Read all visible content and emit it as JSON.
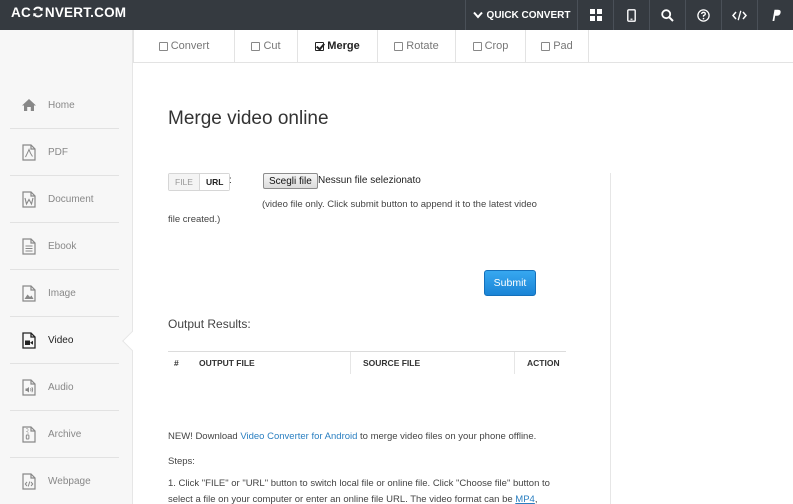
{
  "header": {
    "logo_left": "AC",
    "logo_right": "NVERT.COM",
    "quick_convert": "QUICK CONVERT"
  },
  "tabs": [
    {
      "label": "Convert",
      "active": false
    },
    {
      "label": "Cut",
      "active": false
    },
    {
      "label": "Merge",
      "active": true
    },
    {
      "label": "Rotate",
      "active": false
    },
    {
      "label": "Crop",
      "active": false
    },
    {
      "label": "Pad",
      "active": false
    }
  ],
  "sidebar": {
    "items": [
      {
        "label": "Home",
        "icon": "home-icon"
      },
      {
        "label": "PDF",
        "icon": "pdf-icon"
      },
      {
        "label": "Document",
        "icon": "document-icon"
      },
      {
        "label": "Ebook",
        "icon": "ebook-icon"
      },
      {
        "label": "Image",
        "icon": "image-icon"
      },
      {
        "label": "Video",
        "icon": "video-icon",
        "active": true
      },
      {
        "label": "Audio",
        "icon": "audio-icon"
      },
      {
        "label": "Archive",
        "icon": "archive-icon"
      },
      {
        "label": "Webpage",
        "icon": "webpage-icon"
      }
    ]
  },
  "main": {
    "title": "Merge video online",
    "toggle_file": "FILE",
    "toggle_url": "URL",
    "colon": ":",
    "choose_file": "Scegli file",
    "no_file": "Nessun file selezionato",
    "help_line1": "(video file only. Click submit button to append it to the latest video",
    "help_line2": "file created.)",
    "submit": "Submit",
    "results_title": "Output Results:",
    "table_headers": [
      "#",
      "OUTPUT FILE",
      "SOURCE FILE",
      "ACTION"
    ],
    "new_prefix": "NEW! Download ",
    "new_link": "Video Converter for Android",
    "new_suffix": " to merge video files on your phone offline.",
    "steps_label": "Steps:",
    "step1_line1": "1. Click \"FILE\" or \"URL\" button to switch local file or online file. Click \"Choose file\" button to",
    "step1_line2": "select a file on your computer or enter an online file URL. The video format can be ",
    "step1_link": "MP4",
    "step1_end": ","
  }
}
